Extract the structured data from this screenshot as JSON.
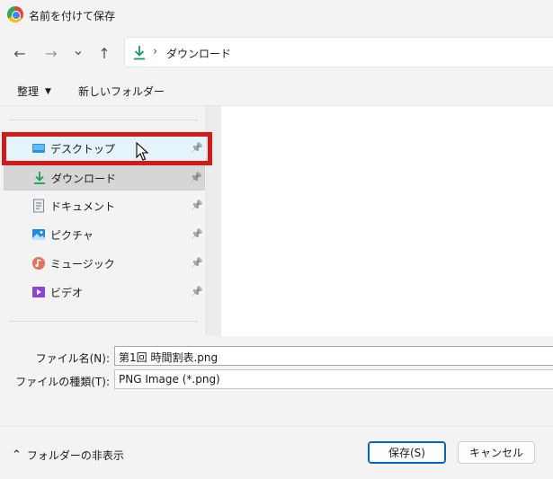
{
  "window": {
    "title": "名前を付けて保存"
  },
  "navigation": {
    "back_icon": "←",
    "forward_icon": "→",
    "dropdown_icon": "⌄",
    "up_icon": "↑",
    "breadcrumb_sep": "›",
    "address": "ダウンロード"
  },
  "toolbar": {
    "organize_label": "整理",
    "organize_caret": "▼",
    "new_folder_label": "新しいフォルダー"
  },
  "sidebar": {
    "pin_icon": "📌",
    "items": [
      {
        "label": "デスクトップ",
        "icon": "desktop-icon"
      },
      {
        "label": "ダウンロード",
        "icon": "download-icon"
      },
      {
        "label": "ドキュメント",
        "icon": "document-icon"
      },
      {
        "label": "ピクチャ",
        "icon": "pictures-icon"
      },
      {
        "label": "ミュージック",
        "icon": "music-icon"
      },
      {
        "label": "ビデオ",
        "icon": "video-icon"
      }
    ]
  },
  "form": {
    "filename_label": "ファイル名(N):",
    "filename_value": "第1回 時間割表.png",
    "filetype_label": "ファイルの種類(T):",
    "filetype_value": "PNG Image (*.png)"
  },
  "footer": {
    "hide_folders_icon": "⌃",
    "hide_folders_label": "フォルダーの非表示",
    "save_label": "保存(S)",
    "cancel_label": "キャンセル"
  },
  "colors": {
    "accent": "#0067c0",
    "highlight_border": "#d11a1a",
    "hover_bg": "#e5f3fb",
    "download_green": "#1a9c5a"
  }
}
